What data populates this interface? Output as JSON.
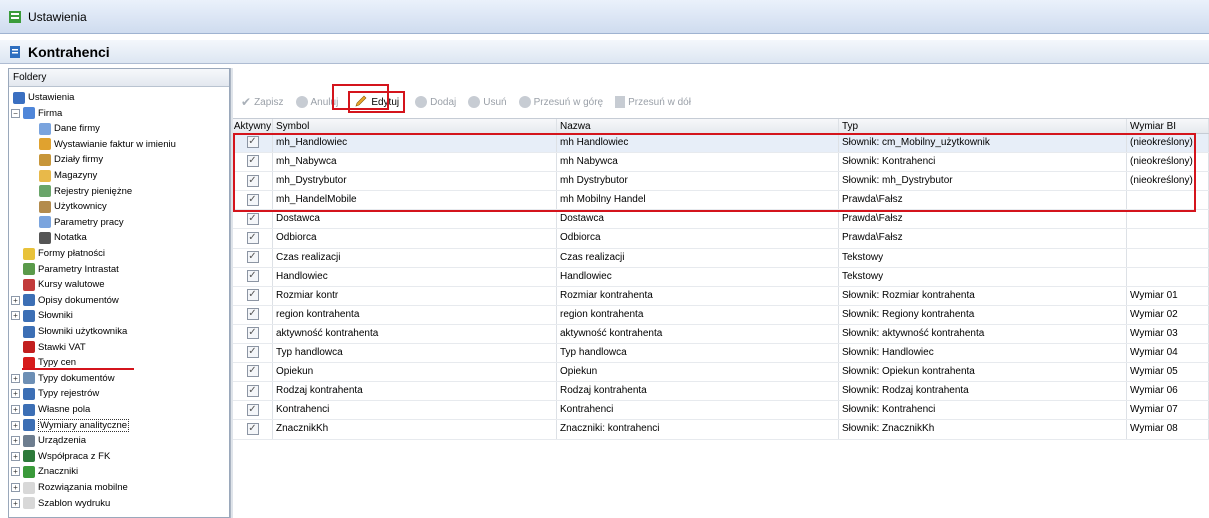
{
  "window": {
    "title": "Ustawienia"
  },
  "module": {
    "title": "Kontrahenci"
  },
  "sidebar": {
    "title": "Foldery",
    "items": [
      {
        "label": "Ustawienia",
        "icon": "settings-icon",
        "level": 0,
        "color": "#3a6fc1"
      },
      {
        "label": "Firma",
        "icon": "company-icon",
        "level": 1,
        "expander": "−",
        "color": "#4f86d9"
      },
      {
        "label": "Dane firmy",
        "icon": "data-icon",
        "level": 2,
        "color": "#7aa4de"
      },
      {
        "label": "Wystawianie faktur w imieniu",
        "icon": "user-icon",
        "level": 2,
        "color": "#e0a22f"
      },
      {
        "label": "Działy firmy",
        "icon": "users-icon",
        "level": 2,
        "color": "#c7963a"
      },
      {
        "label": "Magazyny",
        "icon": "warehouse-icon",
        "level": 2,
        "color": "#e8b94a"
      },
      {
        "label": "Rejestry pieniężne",
        "icon": "money-icon",
        "level": 2,
        "color": "#6aa56a"
      },
      {
        "label": "Użytkownicy",
        "icon": "people-icon",
        "level": 2,
        "color": "#b38b4d"
      },
      {
        "label": "Parametry pracy",
        "icon": "params-icon",
        "level": 2,
        "color": "#7aa4de"
      },
      {
        "label": "Notatka",
        "icon": "note-icon",
        "level": 2,
        "color": "#555555"
      },
      {
        "label": "Formy płatności",
        "icon": "payment-icon",
        "level": 1,
        "color": "#e8c23a"
      },
      {
        "label": "Parametry Intrastat",
        "icon": "intrastat-icon",
        "level": 1,
        "color": "#5a9a4a"
      },
      {
        "label": "Kursy walutowe",
        "icon": "chart-icon",
        "level": 1,
        "color": "#c23b3b"
      },
      {
        "label": "Opisy dokumentów",
        "icon": "doc-icon",
        "level": 1,
        "expander": "+",
        "color": "#3c6fb5"
      },
      {
        "label": "Słowniki",
        "icon": "dict-icon",
        "level": 1,
        "expander": "+",
        "color": "#3c6fb5"
      },
      {
        "label": "Słowniki użytkownika",
        "icon": "dict-icon",
        "level": 1,
        "color": "#3c6fb5"
      },
      {
        "label": "Stawki VAT",
        "icon": "vat-icon",
        "level": 1,
        "color": "#c21f1f"
      },
      {
        "label": "Typy cen",
        "icon": "price-icon",
        "level": 1,
        "color": "#d61c1c"
      },
      {
        "label": "Typy dokumentów",
        "icon": "doc-types-icon",
        "level": 1,
        "expander": "+",
        "color": "#6d8fb5"
      },
      {
        "label": "Typy rejestrów",
        "icon": "registers-icon",
        "level": 1,
        "expander": "+",
        "color": "#3c6fb5"
      },
      {
        "label": "Własne pola",
        "icon": "fields-icon",
        "level": 1,
        "expander": "+",
        "color": "#3c6fb5"
      },
      {
        "label": "Wymiary analityczne",
        "icon": "dimensions-icon",
        "level": 1,
        "expander": "+",
        "color": "#3c6fb5",
        "highlighted": true
      },
      {
        "label": "Urządzenia",
        "icon": "printer-icon",
        "level": 1,
        "expander": "+",
        "color": "#6d7d8f"
      },
      {
        "label": "Współpraca z FK",
        "icon": "fk-icon",
        "level": 1,
        "expander": "+",
        "color": "#2d7a3a"
      },
      {
        "label": "Znaczniki",
        "icon": "tags-icon",
        "level": 1,
        "expander": "+",
        "color": "#3a9a3a"
      },
      {
        "label": "Rozwiązania mobilne",
        "icon": "folder-icon",
        "level": 1,
        "expander": "+",
        "color": "#d8d8d8"
      },
      {
        "label": "Szablon wydruku",
        "icon": "folder-icon",
        "level": 1,
        "expander": "+",
        "color": "#d8d8d8"
      }
    ]
  },
  "toolbar": {
    "save": "Zapisz",
    "cancel": "Anuluj",
    "edit": "Edytuj",
    "add": "Dodaj",
    "delete": "Usuń",
    "move_up": "Przesuń w górę",
    "move_down": "Przesuń w dół"
  },
  "grid": {
    "columns": [
      "Aktywny",
      "Symbol",
      "Nazwa",
      "Typ",
      "Wymiar BI"
    ],
    "rows": [
      {
        "active": true,
        "symbol": "mh_Handlowiec",
        "name": "mh Handlowiec",
        "type": "Słownik: cm_Mobilny_użytkownik",
        "bi": "(nieokreślony)"
      },
      {
        "active": true,
        "symbol": "mh_Nabywca",
        "name": "mh Nabywca",
        "type": "Słownik: Kontrahenci",
        "bi": "(nieokreślony)"
      },
      {
        "active": true,
        "symbol": "mh_Dystrybutor",
        "name": "mh Dystrybutor",
        "type": "Słownik: mh_Dystrybutor",
        "bi": "(nieokreślony)"
      },
      {
        "active": true,
        "symbol": "mh_HandelMobile",
        "name": "mh Mobilny Handel",
        "type": "Prawda\\Fałsz",
        "bi": ""
      },
      {
        "active": true,
        "symbol": "Dostawca",
        "name": "Dostawca",
        "type": "Prawda\\Fałsz",
        "bi": ""
      },
      {
        "active": true,
        "symbol": "Odbiorca",
        "name": "Odbiorca",
        "type": "Prawda\\Fałsz",
        "bi": ""
      },
      {
        "active": true,
        "symbol": "Czas realizacji",
        "name": "Czas realizacji",
        "type": "Tekstowy",
        "bi": ""
      },
      {
        "active": true,
        "symbol": "Handlowiec",
        "name": "Handlowiec",
        "type": "Tekstowy",
        "bi": ""
      },
      {
        "active": true,
        "symbol": "Rozmiar kontr",
        "name": "Rozmiar kontrahenta",
        "type": "Słownik: Rozmiar kontrahenta",
        "bi": "Wymiar 01"
      },
      {
        "active": true,
        "symbol": "region kontrahenta",
        "name": "region kontrahenta",
        "type": "Słownik: Regiony kontrahenta",
        "bi": "Wymiar 02"
      },
      {
        "active": true,
        "symbol": "aktywność kontrahenta",
        "name": "aktywność kontrahenta",
        "type": "Słownik: aktywność kontrahenta",
        "bi": "Wymiar 03"
      },
      {
        "active": true,
        "symbol": "Typ handlowca",
        "name": "Typ handlowca",
        "type": "Słownik: Handlowiec",
        "bi": "Wymiar 04"
      },
      {
        "active": true,
        "symbol": "Opiekun",
        "name": "Opiekun",
        "type": "Słownik: Opiekun kontrahenta",
        "bi": "Wymiar 05"
      },
      {
        "active": true,
        "symbol": "Rodzaj kontrahenta",
        "name": "Rodzaj kontrahenta",
        "type": "Słownik: Rodzaj kontrahenta",
        "bi": "Wymiar 06"
      },
      {
        "active": true,
        "symbol": "Kontrahenci",
        "name": "Kontrahenci",
        "type": "Słownik: Kontrahenci",
        "bi": "Wymiar 07"
      },
      {
        "active": true,
        "symbol": "ZnacznikKh",
        "name": "Znaczniki: kontrahenci",
        "type": "Słownik: ZnacznikKh",
        "bi": "Wymiar 08"
      }
    ]
  },
  "colors": {
    "highlight": "#d4141c",
    "selected_row": "#e7eef8"
  }
}
